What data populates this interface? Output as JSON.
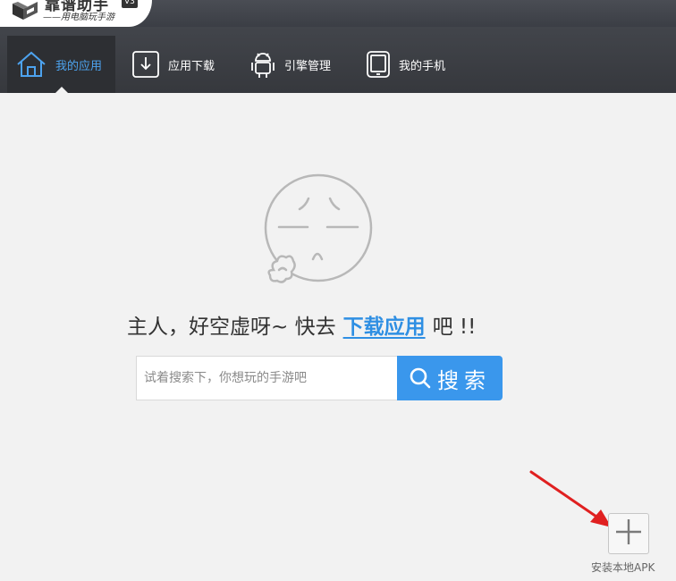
{
  "app": {
    "name": "靠谱助手",
    "version": "V3",
    "slogan": "——用电脑玩手游"
  },
  "nav": {
    "tabs": [
      {
        "label": "我的应用",
        "icon": "home-icon",
        "active": true
      },
      {
        "label": "应用下载",
        "icon": "download-icon",
        "active": false
      },
      {
        "label": "引擎管理",
        "icon": "android-icon",
        "active": false
      },
      {
        "label": "我的手机",
        "icon": "phone-icon",
        "active": false
      }
    ]
  },
  "main": {
    "empty_message_prefix": "主人，好空虚呀~ 快去",
    "download_link": "下载应用",
    "empty_message_suffix": "吧 !!",
    "search": {
      "placeholder": "试着搜索下，你想玩的手游吧",
      "value": "",
      "button_label": "搜索"
    },
    "install_apk_label": "安装本地APK"
  },
  "colors": {
    "accent": "#3a97ec",
    "nav_bg": "#3d4046",
    "active_tab_text": "#4da3ef",
    "annotation_arrow": "#e02020"
  },
  "icons": {
    "face": "bored-face-icon",
    "search": "search-icon",
    "install": "plus-icon",
    "annotation": "red-arrow-annotation"
  }
}
